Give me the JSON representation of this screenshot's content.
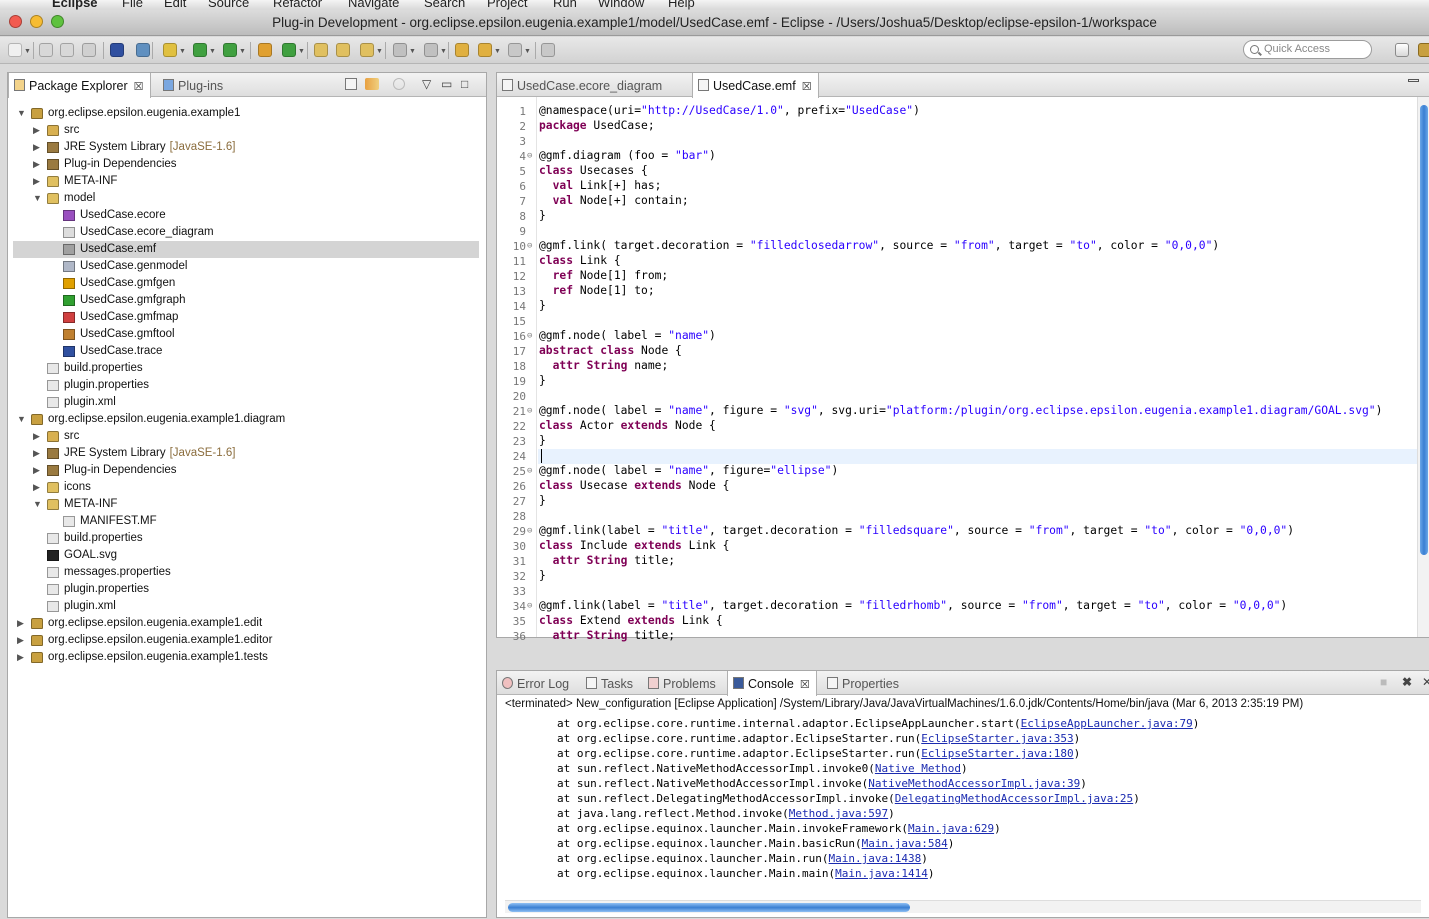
{
  "menubar": {
    "items": [
      "Eclipse",
      "File",
      "Edit",
      "Source",
      "Refactor",
      "Navigate",
      "Search",
      "Project",
      "Run",
      "Window",
      "Help"
    ]
  },
  "window": {
    "title": "Plug-in Development - org.eclipse.epsilon.eugenia.example1/model/UsedCase.emf - Eclipse - /Users/Joshua5/Desktop/eclipse-epsilon-1/workspace"
  },
  "toolbar": {
    "quick_access_placeholder": "Quick Access"
  },
  "explorer": {
    "tabs": [
      {
        "label": "Package Explorer",
        "close": "☒"
      },
      {
        "label": "Plug-ins"
      }
    ],
    "controls": {
      "minimize": "▭",
      "maximize": "□",
      "menu": "▽"
    },
    "tree": [
      {
        "depth": 0,
        "twisty": "▼",
        "icon": "project-icon",
        "color": "#c8a040",
        "label": "org.eclipse.epsilon.eugenia.example1"
      },
      {
        "depth": 1,
        "twisty": "▶",
        "icon": "source-folder-icon",
        "color": "#d8b050",
        "label": "src"
      },
      {
        "depth": 1,
        "twisty": "▶",
        "icon": "library-icon",
        "color": "#9a7a40",
        "label": "JRE System Library",
        "decoration": "[JavaSE-1.6]"
      },
      {
        "depth": 1,
        "twisty": "▶",
        "icon": "library-icon",
        "color": "#9a7a40",
        "label": "Plug-in Dependencies"
      },
      {
        "depth": 1,
        "twisty": "▶",
        "icon": "folder-icon",
        "color": "#e0c060",
        "label": "META-INF"
      },
      {
        "depth": 1,
        "twisty": "▼",
        "icon": "folder-icon",
        "color": "#e0c060",
        "label": "model"
      },
      {
        "depth": 2,
        "twisty": "",
        "icon": "ecore-file-icon",
        "color": "#9a50c0",
        "label": "UsedCase.ecore"
      },
      {
        "depth": 2,
        "twisty": "",
        "icon": "file-icon",
        "color": "#dddddd",
        "label": "UsedCase.ecore_diagram"
      },
      {
        "depth": 2,
        "twisty": "",
        "icon": "emf-file-icon",
        "color": "#a0a0a0",
        "label": "UsedCase.emf",
        "selected": true
      },
      {
        "depth": 2,
        "twisty": "",
        "icon": "genmodel-file-icon",
        "color": "#b0b8c8",
        "label": "UsedCase.genmodel"
      },
      {
        "depth": 2,
        "twisty": "",
        "icon": "gmfgen-file-icon",
        "color": "#e0a000",
        "label": "UsedCase.gmfgen"
      },
      {
        "depth": 2,
        "twisty": "",
        "icon": "gmfgraph-file-icon",
        "color": "#30a030",
        "label": "UsedCase.gmfgraph"
      },
      {
        "depth": 2,
        "twisty": "",
        "icon": "gmfmap-file-icon",
        "color": "#d04040",
        "label": "UsedCase.gmfmap"
      },
      {
        "depth": 2,
        "twisty": "",
        "icon": "gmftool-file-icon",
        "color": "#c08030",
        "label": "UsedCase.gmftool"
      },
      {
        "depth": 2,
        "twisty": "",
        "icon": "trace-file-icon",
        "color": "#3050a0",
        "label": "UsedCase.trace"
      },
      {
        "depth": 1,
        "twisty": "",
        "icon": "properties-file-icon",
        "color": "#e8e8e8",
        "label": "build.properties"
      },
      {
        "depth": 1,
        "twisty": "",
        "icon": "properties-file-icon",
        "color": "#e8e8e8",
        "label": "plugin.properties"
      },
      {
        "depth": 1,
        "twisty": "",
        "icon": "xml-file-icon",
        "color": "#e8e8e8",
        "label": "plugin.xml"
      },
      {
        "depth": 0,
        "twisty": "▼",
        "icon": "project-icon",
        "color": "#c8a040",
        "label": "org.eclipse.epsilon.eugenia.example1.diagram"
      },
      {
        "depth": 1,
        "twisty": "▶",
        "icon": "source-folder-icon",
        "color": "#d8b050",
        "label": "src"
      },
      {
        "depth": 1,
        "twisty": "▶",
        "icon": "library-icon",
        "color": "#9a7a40",
        "label": "JRE System Library",
        "decoration": "[JavaSE-1.6]"
      },
      {
        "depth": 1,
        "twisty": "▶",
        "icon": "library-icon",
        "color": "#9a7a40",
        "label": "Plug-in Dependencies"
      },
      {
        "depth": 1,
        "twisty": "▶",
        "icon": "folder-icon",
        "color": "#e0c060",
        "label": "icons"
      },
      {
        "depth": 1,
        "twisty": "▼",
        "icon": "folder-icon",
        "color": "#e0c060",
        "label": "META-INF"
      },
      {
        "depth": 2,
        "twisty": "",
        "icon": "manifest-file-icon",
        "color": "#e8e8e8",
        "label": "MANIFEST.MF"
      },
      {
        "depth": 1,
        "twisty": "",
        "icon": "properties-file-icon",
        "color": "#e8e8e8",
        "label": "build.properties"
      },
      {
        "depth": 1,
        "twisty": "",
        "icon": "svg-file-icon",
        "color": "#222222",
        "label": "GOAL.svg"
      },
      {
        "depth": 1,
        "twisty": "",
        "icon": "properties-file-icon",
        "color": "#e8e8e8",
        "label": "messages.properties"
      },
      {
        "depth": 1,
        "twisty": "",
        "icon": "properties-file-icon",
        "color": "#e8e8e8",
        "label": "plugin.properties"
      },
      {
        "depth": 1,
        "twisty": "",
        "icon": "xml-file-icon",
        "color": "#e8e8e8",
        "label": "plugin.xml"
      },
      {
        "depth": 0,
        "twisty": "▶",
        "icon": "project-icon",
        "color": "#c8a040",
        "label": "org.eclipse.epsilon.eugenia.example1.edit"
      },
      {
        "depth": 0,
        "twisty": "▶",
        "icon": "project-icon",
        "color": "#c8a040",
        "label": "org.eclipse.epsilon.eugenia.example1.editor"
      },
      {
        "depth": 0,
        "twisty": "▶",
        "icon": "project-icon",
        "color": "#c8a040",
        "label": "org.eclipse.epsilon.eugenia.example1.tests"
      }
    ]
  },
  "editor": {
    "tabs": [
      {
        "label": "UsedCase.ecore_diagram"
      },
      {
        "label": "UsedCase.emf",
        "close": "☒"
      }
    ],
    "current_line": 24,
    "lines": [
      [
        [
          "n",
          "@namespace(uri="
        ],
        [
          "s",
          "\"http://UsedCase/1.0\""
        ],
        [
          "n",
          ", prefix="
        ],
        [
          "s",
          "\"UsedCase\""
        ],
        [
          "n",
          ")"
        ]
      ],
      [
        [
          "k",
          "package"
        ],
        [
          "n",
          " UsedCase;"
        ]
      ],
      [],
      [
        [
          "n",
          "@gmf.diagram (foo = "
        ],
        [
          "s",
          "\"bar\""
        ],
        [
          "n",
          ")"
        ]
      ],
      [
        [
          "k",
          "class"
        ],
        [
          "n",
          " Usecases {"
        ]
      ],
      [
        [
          "n",
          "  "
        ],
        [
          "k",
          "val"
        ],
        [
          "n",
          " Link[+] has;"
        ]
      ],
      [
        [
          "n",
          "  "
        ],
        [
          "k",
          "val"
        ],
        [
          "n",
          " Node[+] contain;"
        ]
      ],
      [
        [
          "n",
          "}"
        ]
      ],
      [],
      [
        [
          "n",
          "@gmf.link( target.decoration = "
        ],
        [
          "s",
          "\"filledclosedarrow\""
        ],
        [
          "n",
          ", source = "
        ],
        [
          "s",
          "\"from\""
        ],
        [
          "n",
          ", target = "
        ],
        [
          "s",
          "\"to\""
        ],
        [
          "n",
          ", color = "
        ],
        [
          "s",
          "\"0,0,0\""
        ],
        [
          "n",
          ")"
        ]
      ],
      [
        [
          "k",
          "class"
        ],
        [
          "n",
          " Link {"
        ]
      ],
      [
        [
          "n",
          "  "
        ],
        [
          "k",
          "ref"
        ],
        [
          "n",
          " Node[1] from;"
        ]
      ],
      [
        [
          "n",
          "  "
        ],
        [
          "k",
          "ref"
        ],
        [
          "n",
          " Node[1] to;"
        ]
      ],
      [
        [
          "n",
          "}"
        ]
      ],
      [],
      [
        [
          "n",
          "@gmf.node( label = "
        ],
        [
          "s",
          "\"name\""
        ],
        [
          "n",
          ")"
        ]
      ],
      [
        [
          "k",
          "abstract"
        ],
        [
          "n",
          " "
        ],
        [
          "k",
          "class"
        ],
        [
          "n",
          " Node {"
        ]
      ],
      [
        [
          "n",
          "  "
        ],
        [
          "k",
          "attr"
        ],
        [
          "n",
          " "
        ],
        [
          "k",
          "String"
        ],
        [
          "n",
          " name;"
        ]
      ],
      [
        [
          "n",
          "}"
        ]
      ],
      [],
      [
        [
          "n",
          "@gmf.node( label = "
        ],
        [
          "s",
          "\"name\""
        ],
        [
          "n",
          ", figure = "
        ],
        [
          "s",
          "\"svg\""
        ],
        [
          "n",
          ", svg.uri="
        ],
        [
          "s",
          "\"platform:/plugin/org.eclipse.epsilon.eugenia.example1.diagram/GOAL.svg\""
        ],
        [
          "n",
          ")"
        ]
      ],
      [
        [
          "k",
          "class"
        ],
        [
          "n",
          " Actor "
        ],
        [
          "k",
          "extends"
        ],
        [
          "n",
          " Node {"
        ]
      ],
      [
        [
          "n",
          "}"
        ]
      ],
      [],
      [
        [
          "n",
          "@gmf.node( label = "
        ],
        [
          "s",
          "\"name\""
        ],
        [
          "n",
          ", figure="
        ],
        [
          "s",
          "\"ellipse\""
        ],
        [
          "n",
          ")"
        ]
      ],
      [
        [
          "k",
          "class"
        ],
        [
          "n",
          " Usecase "
        ],
        [
          "k",
          "extends"
        ],
        [
          "n",
          " Node {"
        ]
      ],
      [
        [
          "n",
          "}"
        ]
      ],
      [],
      [
        [
          "n",
          "@gmf.link(label = "
        ],
        [
          "s",
          "\"title\""
        ],
        [
          "n",
          ", target.decoration = "
        ],
        [
          "s",
          "\"filledsquare\""
        ],
        [
          "n",
          ", source = "
        ],
        [
          "s",
          "\"from\""
        ],
        [
          "n",
          ", target = "
        ],
        [
          "s",
          "\"to\""
        ],
        [
          "n",
          ", color = "
        ],
        [
          "s",
          "\"0,0,0\""
        ],
        [
          "n",
          ")"
        ]
      ],
      [
        [
          "k",
          "class"
        ],
        [
          "n",
          " Include "
        ],
        [
          "k",
          "extends"
        ],
        [
          "n",
          " Link {"
        ]
      ],
      [
        [
          "n",
          "  "
        ],
        [
          "k",
          "attr"
        ],
        [
          "n",
          " "
        ],
        [
          "k",
          "String"
        ],
        [
          "n",
          " title;"
        ]
      ],
      [
        [
          "n",
          "}"
        ]
      ],
      [],
      [
        [
          "n",
          "@gmf.link(label = "
        ],
        [
          "s",
          "\"title\""
        ],
        [
          "n",
          ", target.decoration = "
        ],
        [
          "s",
          "\"filledrhomb\""
        ],
        [
          "n",
          ", source = "
        ],
        [
          "s",
          "\"from\""
        ],
        [
          "n",
          ", target = "
        ],
        [
          "s",
          "\"to\""
        ],
        [
          "n",
          ", color = "
        ],
        [
          "s",
          "\"0,0,0\""
        ],
        [
          "n",
          ")"
        ]
      ],
      [
        [
          "k",
          "class"
        ],
        [
          "n",
          " Extend "
        ],
        [
          "k",
          "extends"
        ],
        [
          "n",
          " Link {"
        ]
      ],
      [
        [
          "n",
          "  "
        ],
        [
          "k",
          "attr"
        ],
        [
          "n",
          " "
        ],
        [
          "k",
          "String"
        ],
        [
          "n",
          " title;"
        ]
      ]
    ],
    "fold_lines": [
      4,
      10,
      16,
      21,
      25,
      29,
      34
    ]
  },
  "console": {
    "tabs": [
      {
        "label": "Error Log"
      },
      {
        "label": "Tasks"
      },
      {
        "label": "Problems"
      },
      {
        "label": "Console",
        "close": "☒"
      },
      {
        "label": "Properties"
      }
    ],
    "controls": {
      "terminate": "■",
      "remove": "✖",
      "more": "✕"
    },
    "terminated": "<terminated> New_configuration [Eclipse Application] /System/Library/Java/JavaVirtualMachines/1.6.0.jdk/Contents/Home/bin/java (Mar 6, 2013 2:35:19 PM)",
    "lines": [
      {
        "text": "at org.eclipse.core.runtime.internal.adaptor.EclipseAppLauncher.start(",
        "link": "EclipseAppLauncher.java:79",
        "end": ")"
      },
      {
        "text": "at org.eclipse.core.runtime.adaptor.EclipseStarter.run(",
        "link": "EclipseStarter.java:353",
        "end": ")"
      },
      {
        "text": "at org.eclipse.core.runtime.adaptor.EclipseStarter.run(",
        "link": "EclipseStarter.java:180",
        "end": ")"
      },
      {
        "text": "at sun.reflect.NativeMethodAccessorImpl.invoke0(",
        "link": "Native Method",
        "end": ")"
      },
      {
        "text": "at sun.reflect.NativeMethodAccessorImpl.invoke(",
        "link": "NativeMethodAccessorImpl.java:39",
        "end": ")"
      },
      {
        "text": "at sun.reflect.DelegatingMethodAccessorImpl.invoke(",
        "link": "DelegatingMethodAccessorImpl.java:25",
        "end": ")"
      },
      {
        "text": "at java.lang.reflect.Method.invoke(",
        "link": "Method.java:597",
        "end": ")"
      },
      {
        "text": "at org.eclipse.equinox.launcher.Main.invokeFramework(",
        "link": "Main.java:629",
        "end": ")"
      },
      {
        "text": "at org.eclipse.equinox.launcher.Main.basicRun(",
        "link": "Main.java:584",
        "end": ")"
      },
      {
        "text": "at org.eclipse.equinox.launcher.Main.run(",
        "link": "Main.java:1438",
        "end": ")"
      },
      {
        "text": "at org.eclipse.equinox.launcher.Main.main(",
        "link": "Main.java:1414",
        "end": ")"
      }
    ]
  },
  "colors": {
    "keyword": "#7f0055",
    "string": "#2a00ff",
    "link": "#1b2bb0",
    "selection": "#d4d4d4",
    "scroll_thumb": "#3a7fd2"
  }
}
